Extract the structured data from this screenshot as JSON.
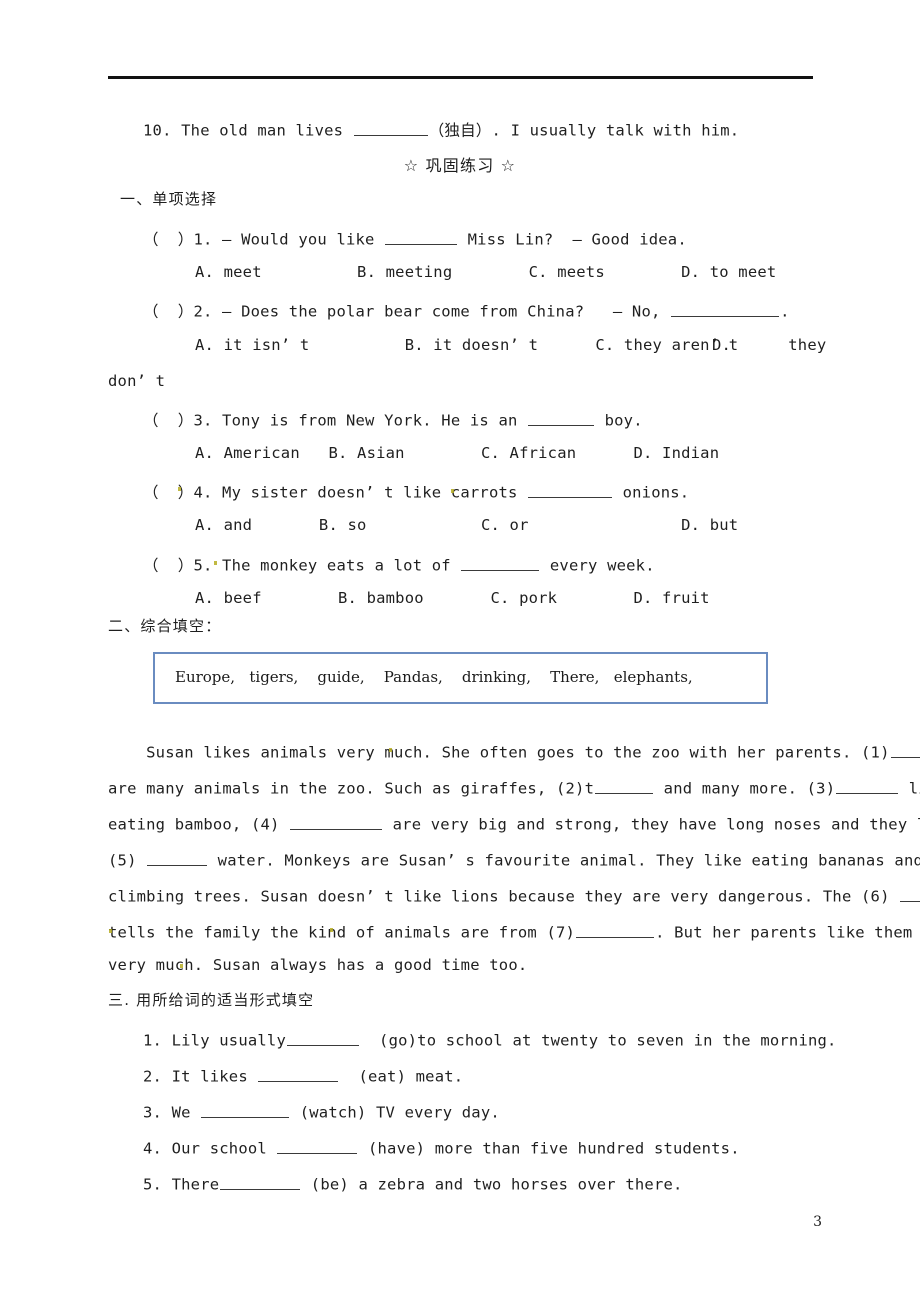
{
  "page": {
    "number": "3",
    "star_heading": "☆ 巩固练习 ☆"
  },
  "carryover_item": {
    "text_before": "10. The old man lives ",
    "blank_after": "（独自）. I usually talk with him."
  },
  "section_one": {
    "heading": "一、单项选择",
    "questions": [
      {
        "stem_before": "（  ）1. — Would you like ",
        "stem_after": " Miss Lin?  — Good idea.",
        "options": "A. meet          B. meeting        C. meets        D. to meet"
      },
      {
        "stem_before": "（  ）2. — Does the polar bear come from China?   — No, ",
        "stem_after": ".",
        "options_a": "A. it isn’ t          B. it doesn’ t      C. they aren’ t",
        "options_d": "D.      they",
        "options_overflow": "don’ t"
      },
      {
        "stem_before": "（  ）3. Tony is from New York. He is an ",
        "stem_after": " boy.",
        "options": "A. American   B. Asian        C. African      D. Indian"
      },
      {
        "stem_before": "（  ）4. My sister doesn’ t like carrots ",
        "stem_after": " onions.",
        "options": "A. and       B. so            C. or                D. but"
      },
      {
        "stem_before": "（  ）5. The monkey eats a lot of ",
        "stem_after": " every week.",
        "options": "A. beef        B. bamboo       C. pork        D. fruit"
      }
    ]
  },
  "section_two": {
    "heading": "二、综合填空：",
    "word_bank": "Europe,   tigers,    guide,    Pandas,    drinking,    There,   elephants,",
    "passage_lines": [
      {
        "before": "    Susan likes animals very much. She often goes to the zoo with her parents. (1)",
        "blank": 52,
        "after": ""
      },
      {
        "before": "are many animals in the zoo. Such as giraffes, (2)t",
        "blank": 58,
        "after": " and many more. (3)",
        "blank2": 62,
        "after2": " like"
      },
      {
        "before": "eating bamboo, (4) ",
        "blank": 92,
        "after": " are very big and strong, they have long noses and they like"
      },
      {
        "before": "(5) ",
        "blank": 60,
        "after": " water. Monkeys are Susan’ s favourite animal. They like eating bananas and"
      },
      {
        "before": "climbing trees. Susan doesn’ t like lions because they are very dangerous. The (6) ",
        "blank": 58,
        "after": ""
      },
      {
        "before": "tells the family the kind of animals are from (7)",
        "blank": 78,
        "after": ". But her parents like them"
      },
      {
        "before": "very much. Susan always has a good time too.",
        "blank": 0,
        "after": ""
      }
    ]
  },
  "section_three": {
    "heading": "三. 用所给词的适当形式填空",
    "questions": [
      {
        "before": "1. Lily usually",
        "blank": 72,
        "after": "  (go)to school at twenty to seven in the morning."
      },
      {
        "before": "2. It likes ",
        "blank": 80,
        "after": "  (eat) meat."
      },
      {
        "before": "3. We ",
        "blank": 88,
        "after": " (watch) TV every day."
      },
      {
        "before": "4. Our school ",
        "blank": 80,
        "after": " (have) more than five hundred students."
      },
      {
        "before": "5. There",
        "blank": 80,
        "after": " (be) a zebra and two horses over there."
      }
    ]
  }
}
